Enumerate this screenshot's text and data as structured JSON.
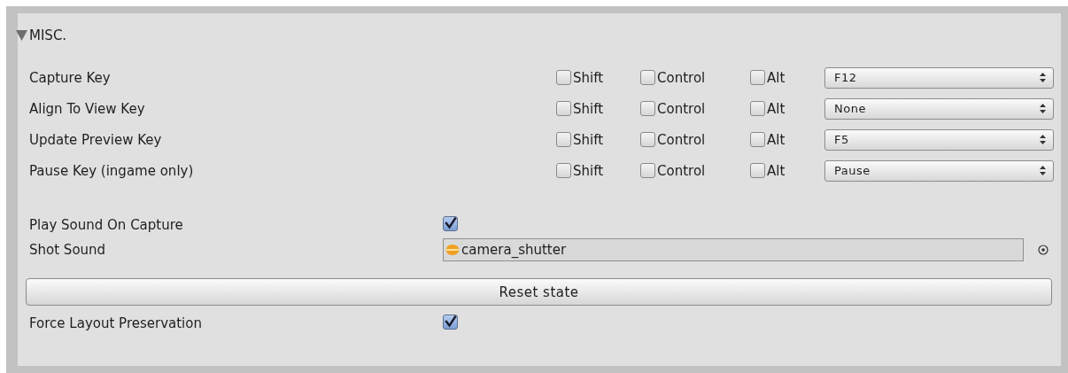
{
  "section": {
    "title": "MISC.",
    "expanded": true
  },
  "key_bindings": [
    {
      "label": "Capture Key",
      "modifiers": [
        {
          "label": "Shift",
          "checked": false
        },
        {
          "label": "Control",
          "checked": false
        },
        {
          "label": "Alt",
          "checked": false
        }
      ],
      "key": "F12"
    },
    {
      "label": "Align To View Key",
      "modifiers": [
        {
          "label": "Shift",
          "checked": false
        },
        {
          "label": "Control",
          "checked": false
        },
        {
          "label": "Alt",
          "checked": false
        }
      ],
      "key": "None"
    },
    {
      "label": "Update Preview Key",
      "modifiers": [
        {
          "label": "Shift",
          "checked": false
        },
        {
          "label": "Control",
          "checked": false
        },
        {
          "label": "Alt",
          "checked": false
        }
      ],
      "key": "F5"
    },
    {
      "label": "Pause Key (ingame only)",
      "modifiers": [
        {
          "label": "Shift",
          "checked": false
        },
        {
          "label": "Control",
          "checked": false
        },
        {
          "label": "Alt",
          "checked": false
        }
      ],
      "key": "Pause"
    }
  ],
  "play_sound_on_capture": {
    "label": "Play Sound On Capture",
    "checked": true
  },
  "shot_sound": {
    "label": "Shot Sound",
    "value": "camera_shutter"
  },
  "reset_button": "Reset state",
  "force_layout_preservation": {
    "label": "Force Layout Preservation",
    "checked": true
  }
}
